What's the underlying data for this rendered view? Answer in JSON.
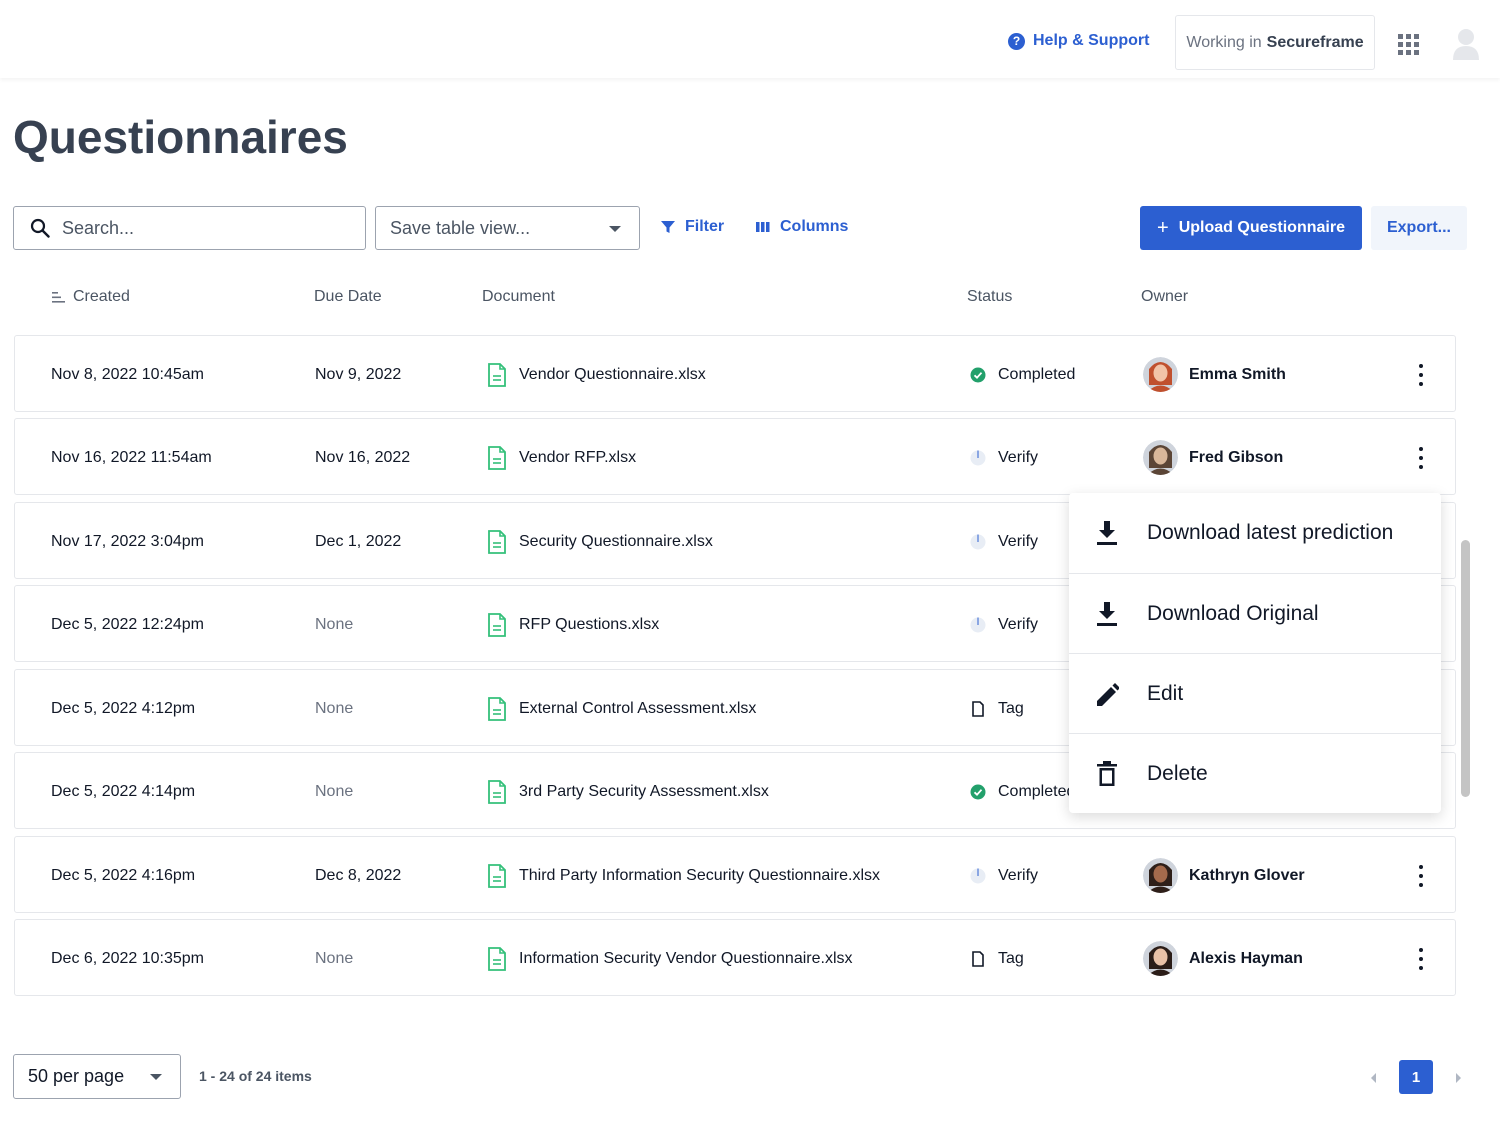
{
  "header": {
    "help_label": "Help & Support",
    "workspace_prefix": "Working in",
    "workspace_name": "Secureframe"
  },
  "page": {
    "title": "Questionnaires"
  },
  "toolbar": {
    "search_placeholder": "Search...",
    "save_view_label": "Save table view...",
    "filter_label": "Filter",
    "columns_label": "Columns",
    "upload_label": "Upload Questionnaire",
    "export_label": "Export..."
  },
  "table": {
    "columns": [
      "Created",
      "Due Date",
      "Document",
      "Status",
      "Owner"
    ],
    "rows": [
      {
        "created": "Nov 8, 2022 10:45am",
        "due": "Nov 9, 2022",
        "document": "Vendor Questionnaire.xlsx",
        "status": "Completed",
        "status_icon": "check-circle-icon",
        "owner": "Emma Smith"
      },
      {
        "created": "Nov 16, 2022 11:54am",
        "due": "Nov 16, 2022",
        "document": "Vendor RFP.xlsx",
        "status": "Verify",
        "status_icon": "progress-icon",
        "owner": "Fred Gibson"
      },
      {
        "created": "Nov 17, 2022 3:04pm",
        "due": "Dec 1, 2022",
        "document": "Security Questionnaire.xlsx",
        "status": "Verify",
        "status_icon": "progress-icon",
        "owner": ""
      },
      {
        "created": "Dec 5, 2022 12:24pm",
        "due": "None",
        "document": "RFP Questions.xlsx",
        "status": "Verify",
        "status_icon": "progress-icon",
        "owner": ""
      },
      {
        "created": "Dec 5, 2022 4:12pm",
        "due": "None",
        "document": "External Control Assessment.xlsx",
        "status": "Tag",
        "status_icon": "file-icon",
        "owner": ""
      },
      {
        "created": "Dec 5, 2022 4:14pm",
        "due": "None",
        "document": "3rd Party Security Assessment.xlsx",
        "status": "Completed",
        "status_icon": "check-circle-icon",
        "owner": ""
      },
      {
        "created": "Dec 5, 2022 4:16pm",
        "due": "Dec 8, 2022",
        "document": "Third Party Information Security Questionnaire.xlsx",
        "status": "Verify",
        "status_icon": "progress-icon",
        "owner": "Kathryn Glover"
      },
      {
        "created": "Dec 6, 2022 10:35pm",
        "due": "None",
        "document": "Information Security Vendor Questionnaire.xlsx",
        "status": "Tag",
        "status_icon": "file-icon",
        "owner": "Alexis Hayman"
      }
    ]
  },
  "context_menu": {
    "items": [
      "Download latest prediction",
      "Download Original",
      "Edit",
      "Delete"
    ]
  },
  "footer": {
    "per_page": "50 per page",
    "items_summary": "1 - 24 of 24 items",
    "current_page": "1"
  },
  "colors": {
    "accent": "#2c5fd1",
    "success": "#22a06b",
    "doc": "#34c07a"
  }
}
